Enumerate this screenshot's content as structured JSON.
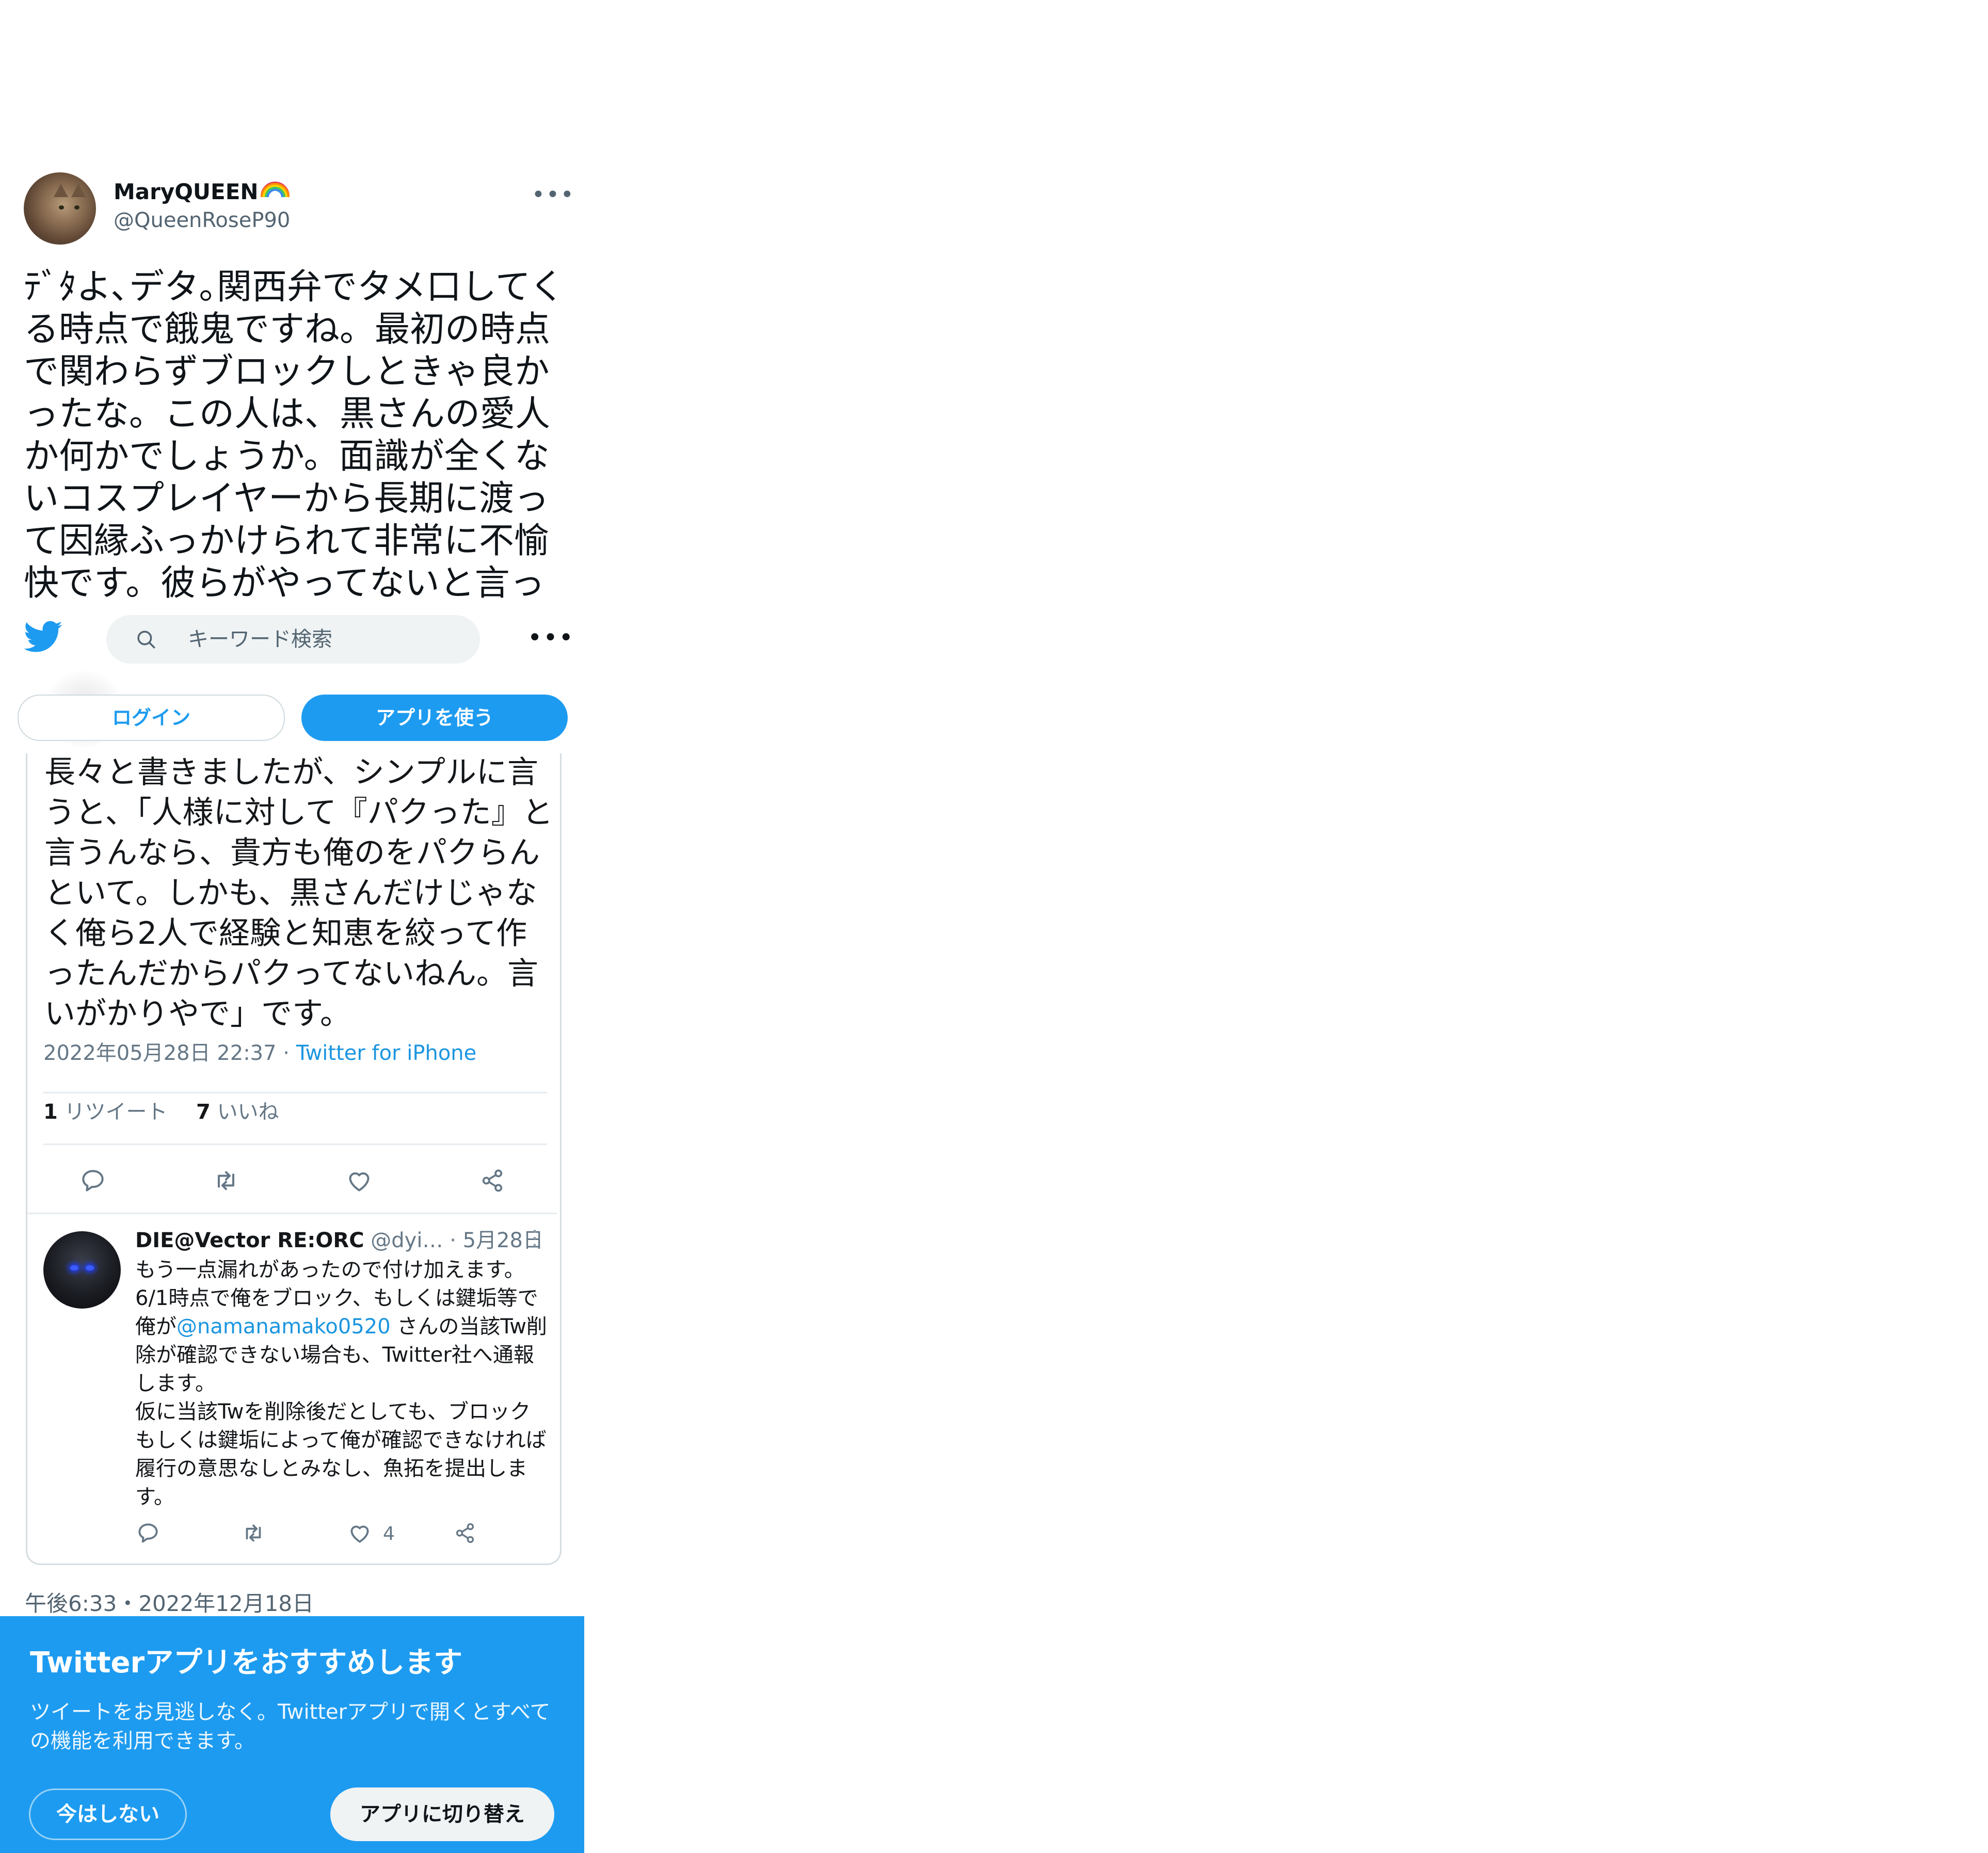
{
  "tweet": {
    "display_name": "MaryQUEEN",
    "name_emoji_icon": "rainbow-icon",
    "handle": "@QueenRoseP90",
    "more_icon": "more-horizontal-icon",
    "text": "ﾃﾞﾀよ､デタ｡関西弁でタメ口してくる時点で餓鬼ですね。最初の時点で関わらずブロックしときゃ良かったな。この人は、黒さんの愛人か何かでしょうか。面識が全くないコスプレイヤーから長期に渡って因縁ふっかけられて非常に不愉快です。彼らがやってないと言っ",
    "posted_at": "午後6:33・2022年12月18日"
  },
  "topbar": {
    "logo_icon": "twitter-bird-icon",
    "search_placeholder": "キーワード検索",
    "search_icon": "search-icon",
    "more_icon": "more-horizontal-icon",
    "login_label": "ログイン",
    "use_app_label": "アプリを使う"
  },
  "quoted": {
    "text": "長々と書きましたが、シンプルに言うと、「人様に対して『パクった』と言うんなら、貴方も俺のをパクらんといて。しかも、黒さんだけじゃなく俺ら2人で経験と知恵を絞って作ったんだからパクってないねん。言いがかりやで」です。",
    "date": "2022年05月28日 22:37",
    "date_sep": " · ",
    "via": "Twitter for iPhone",
    "retweet_count": "1",
    "retweet_label": "リツイート",
    "like_count": "7",
    "like_label": "いいね",
    "reply": {
      "name": "DIE@Vector RE:ORC",
      "handle": "@dyi…",
      "date": "· 5月28日",
      "kebab_icon": "more-vertical-icon",
      "line1": "もう一点漏れがあったので付け加えます。",
      "line2": "6/1時点で俺をブロック、もしくは鍵垢等で俺が",
      "mention": "@namanamako0520",
      "line3": " さんの当該Tw削除が確認できない場合も、Twitter社へ通報します。",
      "line4": "仮に当該Twを削除後だとしても、ブロックもしくは鍵垢によって俺が確認できなければ履行の意思なしとみなし、魚拓を提出します。",
      "like_count": "4"
    }
  },
  "promo": {
    "title": "Twitterアプリをおすすめします",
    "description": "ツイートをお見逃しなく。Twitterアプリで開くとすべての機能を利用できます。",
    "not_now_label": "今はしない",
    "switch_label": "アプリに切り替え"
  },
  "colors": {
    "accent": "#1d9bf0",
    "link": "#1b95e0",
    "muted": "#536471"
  }
}
